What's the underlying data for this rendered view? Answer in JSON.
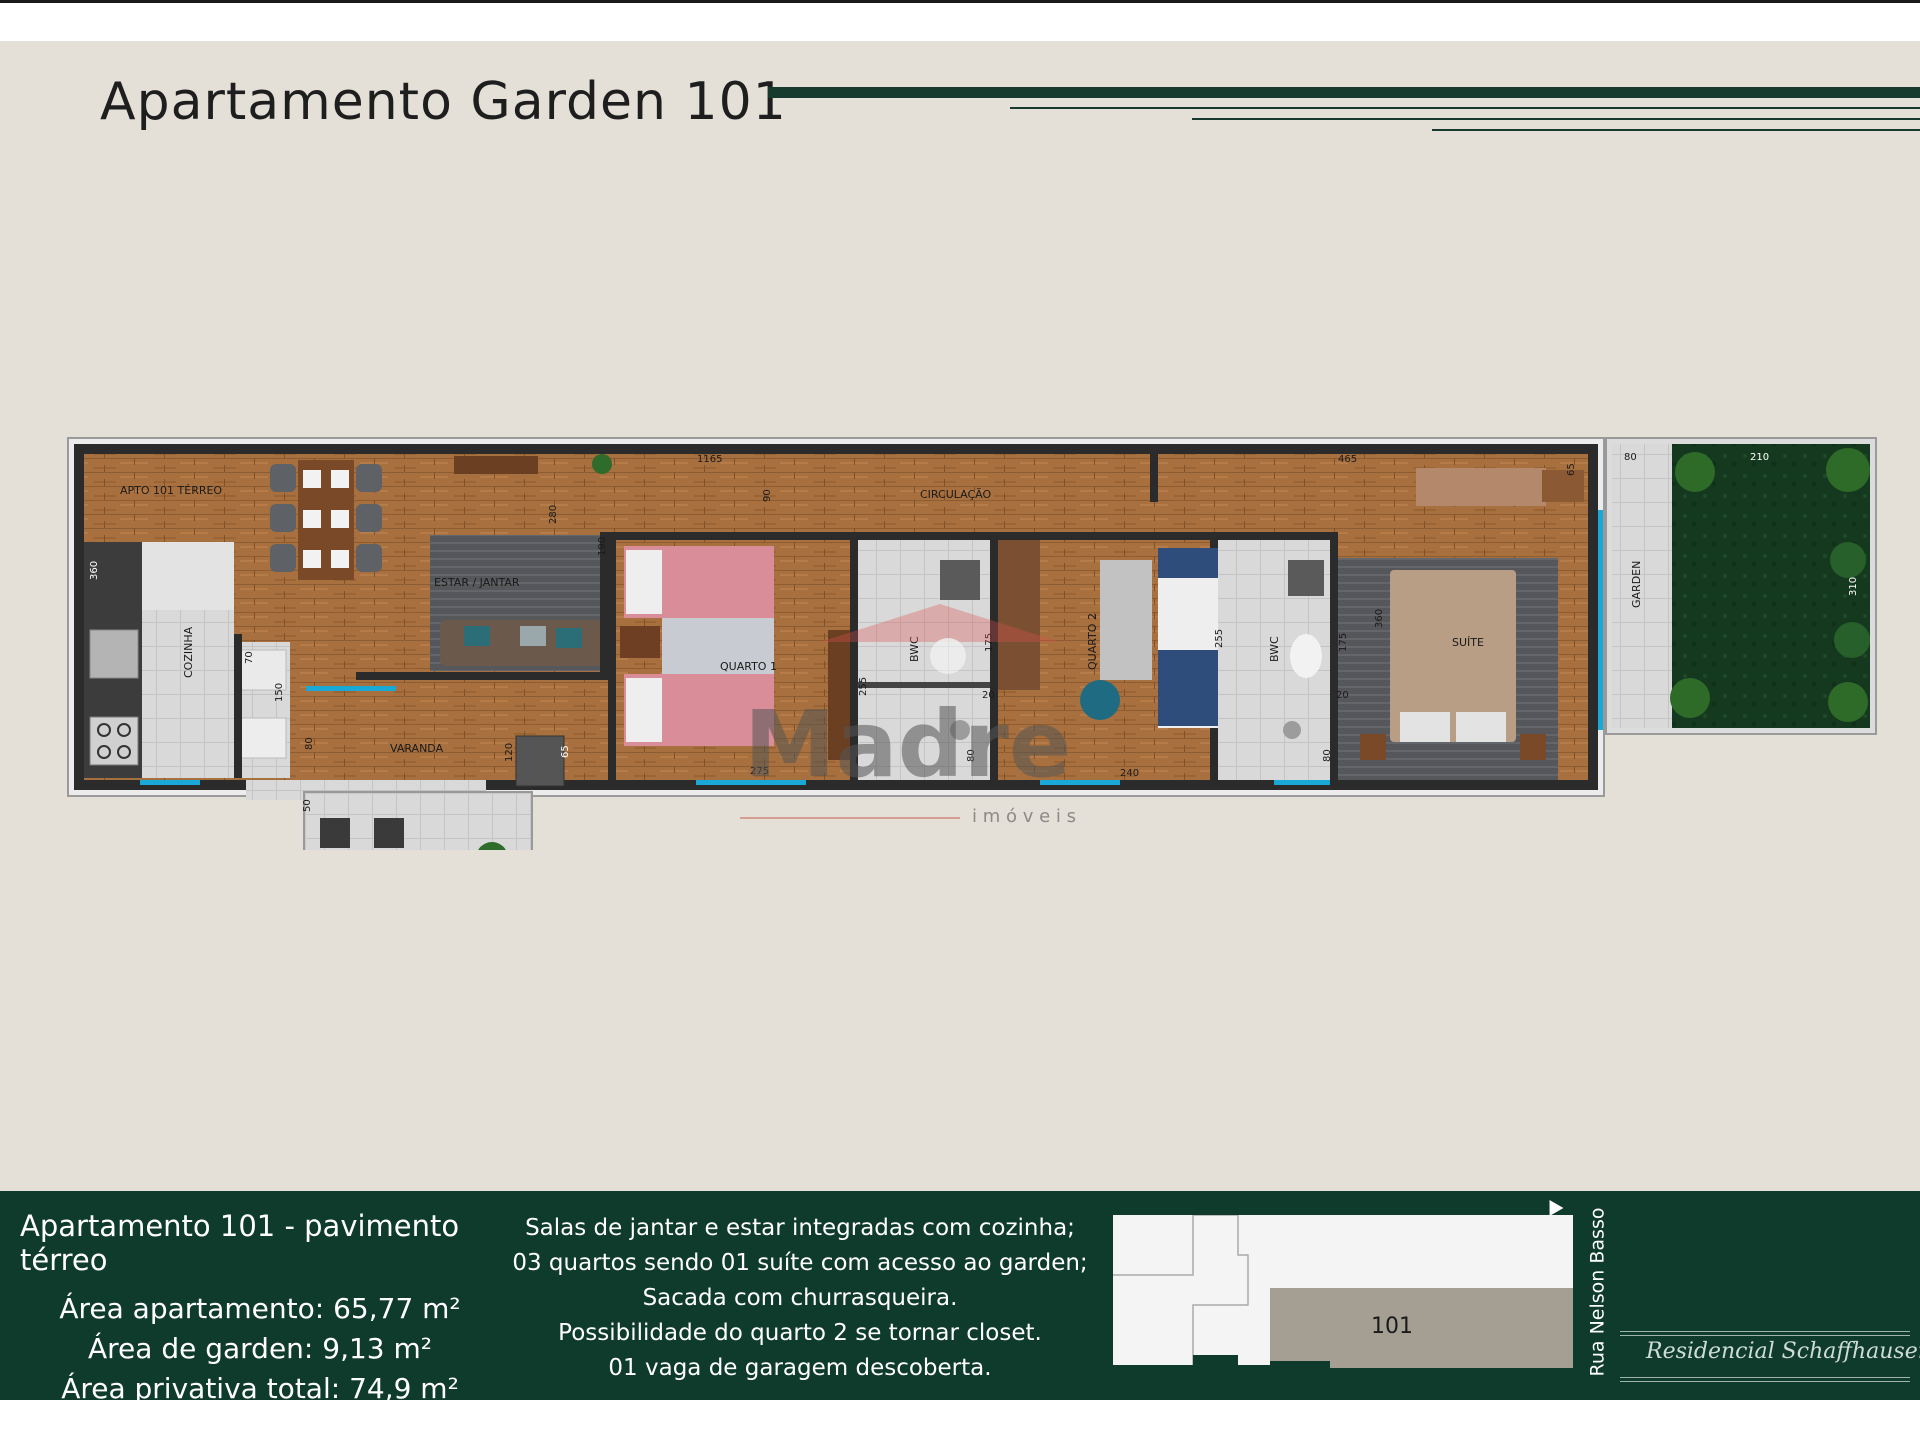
{
  "header": {
    "title": "Apartamento Garden 101"
  },
  "floor_plan": {
    "rooms": {
      "apto": "APTO 101 TÉRREO",
      "circulacao": "CIRCULAÇÃO",
      "cozinha": "COZINHA",
      "estar": "ESTAR / JANTAR",
      "varanda": "VARANDA",
      "quarto1": "QUARTO 1",
      "bwc1": "BWC",
      "quarto2": "QUARTO 2",
      "bwc2": "BWC",
      "suite": "SUÍTE",
      "garden": "GARDEN"
    },
    "dimensions": {
      "d1165": "1165",
      "d465": "465",
      "d80": "80",
      "d210": "210",
      "d310": "310",
      "d90": "90",
      "d280": "280",
      "d190": "190",
      "d360a": "360",
      "d70": "70",
      "d150": "150",
      "d80b": "80",
      "d120": "120",
      "d65a": "65",
      "d50": "50",
      "d255a": "255",
      "d275": "275",
      "d175a": "175",
      "d20a": "20",
      "d80c": "80",
      "d255b": "255",
      "d240": "240",
      "d175b": "175",
      "d20b": "20",
      "d80d": "80",
      "d360b": "360",
      "d65b": "65"
    }
  },
  "watermark": {
    "brand": "Madre",
    "sub": "i m ó v e i s"
  },
  "footer": {
    "heading": "Apartamento 101 - pavimento térreo",
    "areas": [
      "Área apartamento: 65,77 m²",
      "Área de garden: 9,13 m²",
      "Área privativa total: 74,9 m²"
    ],
    "description": [
      "Salas de jantar e estar integradas com cozinha;",
      "03 quartos sendo 01 suíte com acesso ao garden;",
      "Sacada com churrasqueira.",
      "Possibilidade do quarto 2 se tornar closet.",
      "01 vaga de garagem descoberta."
    ],
    "keyplan_unit": "101",
    "street": "Rua Nelson Basso",
    "north": "N",
    "brand": "Residencial Schaffhausen"
  },
  "colors": {
    "accent": "#163a2e",
    "background": "#e4e0d8",
    "floor": "#a8713f"
  }
}
